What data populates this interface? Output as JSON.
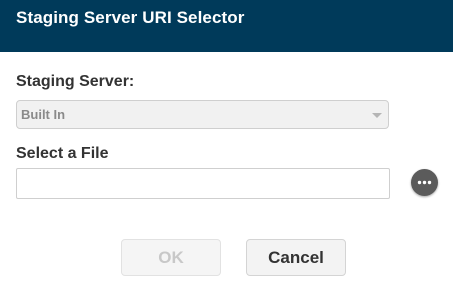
{
  "dialog": {
    "title": "Staging Server URI Selector"
  },
  "staging_server": {
    "label": "Staging Server:",
    "selected_value": "Built In"
  },
  "file": {
    "label": "Select a File",
    "value": "",
    "browse_icon": "ellipsis-icon"
  },
  "buttons": {
    "ok_label": "OK",
    "cancel_label": "Cancel"
  },
  "colors": {
    "title_bar": "#003a5a",
    "disabled_text": "#c8c8c8",
    "browse_button": "#5b5b5b"
  }
}
